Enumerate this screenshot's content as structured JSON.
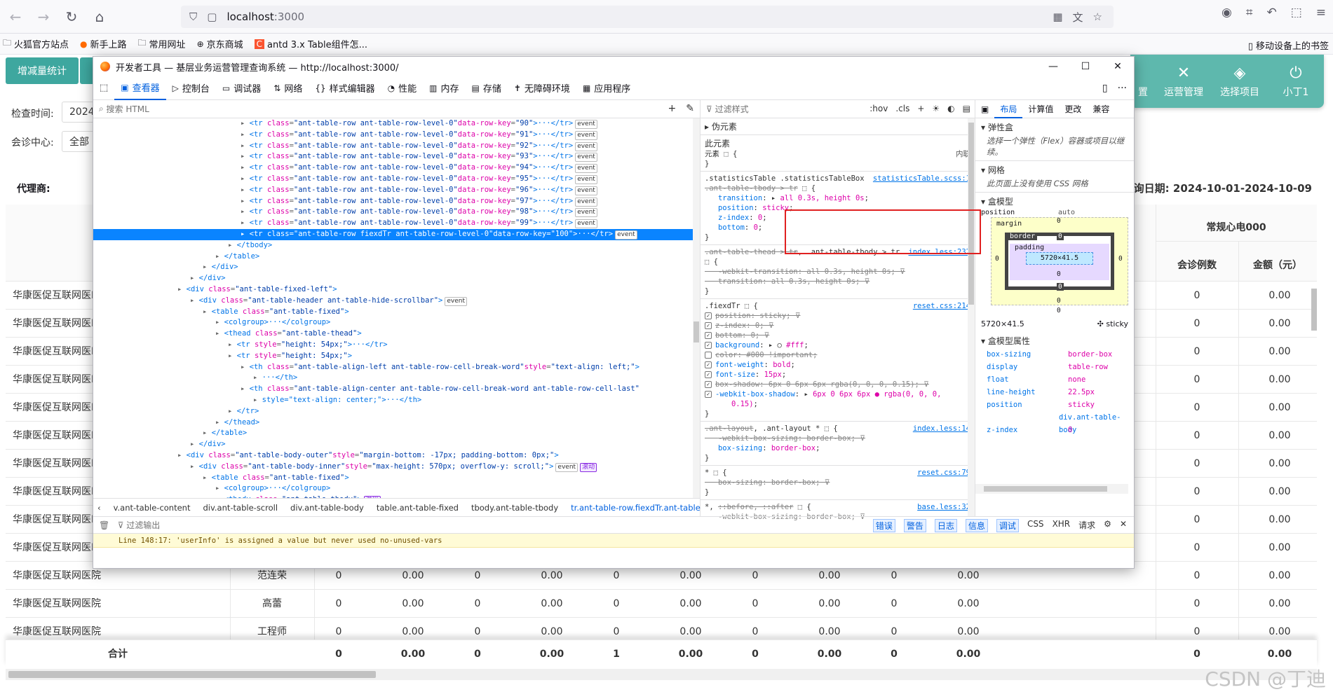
{
  "browser": {
    "url_host": "localhost",
    "url_port": ":3000",
    "bookmarks": [
      "火狐官方站点",
      "新手上路",
      "常用网址",
      "京东商城",
      "antd 3.x Table组件怎..."
    ],
    "mobile_bookmarks": "移动设备上的书签"
  },
  "app": {
    "tab_stats": "增减量统计",
    "check_time_label": "检查时间:",
    "check_time_value": "2024",
    "center_label": "会诊中心:",
    "center_value": "全部",
    "agent_label": "代理商:",
    "query_date": "查询日期:  2024-10-01-2024-10-09",
    "nav": [
      {
        "label": "置",
        "icon": "settings-icon"
      },
      {
        "label": "运营管理",
        "icon": "tools-icon"
      },
      {
        "label": "选择项目",
        "icon": "layers-icon"
      },
      {
        "label": "小丁1",
        "icon": "power-icon"
      }
    ],
    "group_header": "常规心电000",
    "col_cases": "会诊例数",
    "col_amount": "金额（元）",
    "hospital": "华康医促互联网医院",
    "hospital_short": "华康医促互联网医I",
    "rows": [
      {
        "doctor": "",
        "vals": [
          "",
          "",
          "",
          "",
          "",
          "",
          "",
          "",
          "",
          "",
          "0",
          "0.00"
        ]
      },
      {
        "doctor": "",
        "vals": [
          "",
          "",
          "",
          "",
          "",
          "",
          "",
          "",
          "",
          "",
          "0",
          "0.00"
        ]
      },
      {
        "doctor": "",
        "vals": [
          "",
          "",
          "",
          "",
          "",
          "",
          "",
          "",
          "",
          "",
          "0",
          "0.00"
        ]
      },
      {
        "doctor": "",
        "vals": [
          "",
          "",
          "",
          "",
          "",
          "",
          "",
          "",
          "",
          "",
          "0",
          "0.00"
        ]
      },
      {
        "doctor": "",
        "vals": [
          "",
          "",
          "",
          "",
          "",
          "",
          "",
          "",
          "",
          "",
          "0",
          "0.00"
        ]
      },
      {
        "doctor": "",
        "vals": [
          "",
          "",
          "",
          "",
          "",
          "",
          "",
          "",
          "",
          "",
          "0",
          "0.00"
        ]
      },
      {
        "doctor": "",
        "vals": [
          "",
          "",
          "",
          "",
          "",
          "",
          "",
          "",
          "",
          "",
          "0",
          "0.00"
        ]
      },
      {
        "doctor": "",
        "vals": [
          "",
          "",
          "",
          "",
          "",
          "",
          "",
          "",
          "",
          "",
          "0",
          "0.00"
        ]
      },
      {
        "doctor": "",
        "vals": [
          "",
          "",
          "",
          "",
          "",
          "",
          "",
          "",
          "",
          "",
          "0",
          "0.00"
        ]
      },
      {
        "doctor": "",
        "vals": [
          "",
          "",
          "",
          "",
          "",
          "",
          "",
          "",
          "",
          "",
          "0",
          "0.00"
        ]
      },
      {
        "doctor": "范连荣",
        "vals": [
          "0",
          "0.00",
          "0",
          "0.00",
          "0",
          "0.00",
          "0",
          "0.00",
          "0",
          "0.00",
          "0",
          "0.00"
        ]
      },
      {
        "doctor": "高蕾",
        "vals": [
          "0",
          "0.00",
          "0",
          "0.00",
          "0",
          "0.00",
          "0",
          "0.00",
          "0",
          "0.00",
          "0",
          "0.00"
        ]
      },
      {
        "doctor": "工程师",
        "vals": [
          "0",
          "0.00",
          "0",
          "0.00",
          "0",
          "0.00",
          "0",
          "0.00",
          "0",
          "0.00",
          "0",
          "0.00"
        ]
      }
    ],
    "total_label": "合计",
    "total_vals": [
      "0",
      "0.00",
      "0",
      "0.00",
      "1",
      "0.00",
      "0",
      "0.00",
      "0",
      "0.00",
      "0",
      "0.00"
    ],
    "watermark": "CSDN @丁迪"
  },
  "devtools": {
    "title": "开发者工具 — 基层业务运营管理查询系统 — http://localhost:3000/",
    "tabs": [
      "查看器",
      "控制台",
      "调试器",
      "网络",
      "样式编辑器",
      "性能",
      "内存",
      "存储",
      "无障碍环境",
      "应用程序"
    ],
    "search_html": "搜索 HTML",
    "markup_lines": [
      {
        "indent": 30,
        "text": "<tr class=\"ant-table-row ant-table-row-level-0\" data-row-key=\"90\">···</tr>",
        "badge": "event"
      },
      {
        "indent": 30,
        "text": "<tr class=\"ant-table-row ant-table-row-level-0\" data-row-key=\"91\">···</tr>",
        "badge": "event"
      },
      {
        "indent": 30,
        "text": "<tr class=\"ant-table-row ant-table-row-level-0\" data-row-key=\"92\">···</tr>",
        "badge": "event"
      },
      {
        "indent": 30,
        "text": "<tr class=\"ant-table-row ant-table-row-level-0\" data-row-key=\"93\">···</tr>",
        "badge": "event"
      },
      {
        "indent": 30,
        "text": "<tr class=\"ant-table-row ant-table-row-level-0\" data-row-key=\"94\">···</tr>",
        "badge": "event"
      },
      {
        "indent": 30,
        "text": "<tr class=\"ant-table-row ant-table-row-level-0\" data-row-key=\"95\">···</tr>",
        "badge": "event"
      },
      {
        "indent": 30,
        "text": "<tr class=\"ant-table-row ant-table-row-level-0\" data-row-key=\"96\">···</tr>",
        "badge": "event"
      },
      {
        "indent": 30,
        "text": "<tr class=\"ant-table-row ant-table-row-level-0\" data-row-key=\"97\">···</tr>",
        "badge": "event"
      },
      {
        "indent": 30,
        "text": "<tr class=\"ant-table-row ant-table-row-level-0\" data-row-key=\"98\">···</tr>",
        "badge": "event"
      },
      {
        "indent": 30,
        "text": "<tr class=\"ant-table-row ant-table-row-level-0\" data-row-key=\"99\">···</tr>",
        "badge": "event"
      },
      {
        "indent": 30,
        "text": "<tr class=\"ant-table-row fiexdTr ant-table-row-level-0\" data-row-key=\"100\">···</tr>",
        "badge": "event",
        "selected": true
      },
      {
        "indent": 28,
        "text": "</tbody>",
        "badge": ""
      },
      {
        "indent": 26,
        "text": "</table>",
        "badge": ""
      },
      {
        "indent": 24,
        "text": "</div>",
        "badge": ""
      },
      {
        "indent": 22,
        "text": "</div>",
        "badge": ""
      },
      {
        "indent": 20,
        "text": "<div class=\"ant-table-fixed-left\">",
        "badge": ""
      },
      {
        "indent": 22,
        "text": "<div class=\"ant-table-header ant-table-hide-scrollbar\">",
        "badge": "event"
      },
      {
        "indent": 24,
        "text": "<table class=\"ant-table-fixed\">",
        "badge": ""
      },
      {
        "indent": 26,
        "text": "<colgroup>···</colgroup>",
        "badge": ""
      },
      {
        "indent": 26,
        "text": "<thead class=\"ant-table-thead\">",
        "badge": ""
      },
      {
        "indent": 28,
        "text": "<tr style=\"height: 54px;\">···</tr>",
        "badge": ""
      },
      {
        "indent": 28,
        "text": "<tr style=\"height: 54px;\">",
        "badge": ""
      },
      {
        "indent": 30,
        "text": "<th class=\"ant-table-align-left ant-table-row-cell-break-word\" style=\"text-align: left;\">",
        "badge": ""
      },
      {
        "indent": 32,
        "text": "···</th>",
        "badge": ""
      },
      {
        "indent": 30,
        "text": "<th class=\"ant-table-align-center ant-table-row-cell-break-word ant-table-row-cell-last\"",
        "badge": ""
      },
      {
        "indent": 32,
        "text": "style=\"text-align: center;\">···</th>",
        "badge": ""
      },
      {
        "indent": 28,
        "text": "</tr>",
        "badge": ""
      },
      {
        "indent": 26,
        "text": "</thead>",
        "badge": ""
      },
      {
        "indent": 24,
        "text": "</table>",
        "badge": ""
      },
      {
        "indent": 22,
        "text": "</div>",
        "badge": ""
      },
      {
        "indent": 20,
        "text": "<div class=\"ant-table-body-outer\" style=\"margin-bottom: -17px; padding-bottom: 0px;\">",
        "badge": ""
      },
      {
        "indent": 22,
        "text": "<div class=\"ant-table-body-inner\" style=\"max-height: 570px; overflow-y: scroll;\">",
        "badge": "event",
        "badge2": "滚动"
      },
      {
        "indent": 24,
        "text": "<table class=\"ant-table-fixed\">",
        "badge": ""
      },
      {
        "indent": 26,
        "text": "<colgroup>···</colgroup>",
        "badge": ""
      },
      {
        "indent": 26,
        "text": "<tbody class=\"ant-table-tbody\">",
        "badge": "溢出"
      }
    ],
    "breadcrumbs": [
      "v.ant-table-content",
      "div.ant-table-scroll",
      "div.ant-table-body",
      "table.ant-table-fixed",
      "tbody.ant-table-tbody",
      "tr.ant-table-row.fiexdTr.ant-table-row-l..."
    ],
    "rules_filter": "过滤样式",
    "rules_pseudo": "伪元素",
    "rules_this": "此元素",
    "rules_element": "元素 ⬚ {",
    "rules_inline": "内联",
    "layout_tabs": [
      "布局",
      "计算值",
      "更改",
      "兼容"
    ],
    "flex_title": "弹性盒",
    "flex_note": "选择一个弹性（Flex）容器或项目以继续。",
    "grid_title": "网格",
    "grid_note": "此页面上没有使用 CSS 网格",
    "box_title": "盒模型",
    "box_position": "position",
    "box_auto": "auto",
    "box_margin": "margin",
    "box_border": "border",
    "box_padding": "padding",
    "box_content": "5720×41.5",
    "box_size": "5720×41.5",
    "box_sticky": "sticky",
    "box_props_title": "盒模型属性",
    "box_props": [
      {
        "k": "box-sizing",
        "v": "border-box"
      },
      {
        "k": "display",
        "v": "table-row"
      },
      {
        "k": "float",
        "v": "none"
      },
      {
        "k": "line-height",
        "v": "22.5px"
      },
      {
        "k": "position",
        "v": "sticky"
      },
      {
        "k": "",
        "v": "div.ant-table-body"
      },
      {
        "k": "z-index",
        "v": "0"
      }
    ],
    "console_filter": "过滤输出",
    "console_filters": [
      "错误",
      "警告",
      "日志",
      "信息",
      "调试",
      "CSS",
      "XHR",
      "请求"
    ],
    "console_warning": "Line 148:17:  'userInfo' is assigned a value but never used  no-unused-vars"
  }
}
